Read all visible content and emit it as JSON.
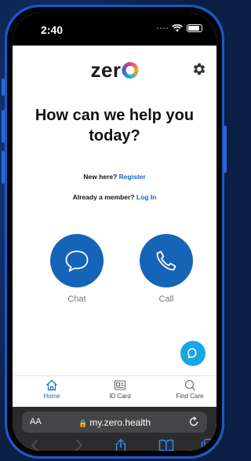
{
  "status_bar": {
    "time": "2:40"
  },
  "header": {
    "logo_text": "zer"
  },
  "headline": "How can we help you today?",
  "new_here": {
    "prompt": "New here?",
    "link": "Register"
  },
  "member": {
    "prompt": "Already a member?",
    "link": "Log In"
  },
  "actions": {
    "chat_label": "Chat",
    "call_label": "Call"
  },
  "tabs": {
    "home": "Home",
    "id_card": "ID Card",
    "find_care": "Find Care"
  },
  "browser": {
    "text_size": "AA",
    "url": "my.zero.health"
  },
  "colors": {
    "primary": "#1564b8",
    "link": "#1765c6",
    "fab": "#17a6e6"
  }
}
